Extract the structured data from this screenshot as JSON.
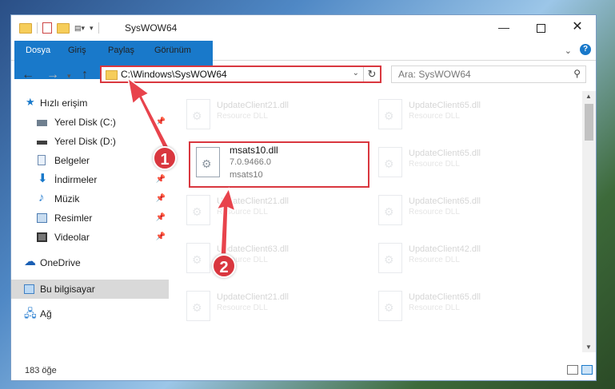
{
  "window": {
    "title": "SysWOW64",
    "controls": {
      "minimize": "—",
      "close": "✕"
    }
  },
  "ribbon": {
    "tabs": [
      "Dosya",
      "Giriş",
      "Paylaş",
      "Görünüm"
    ],
    "help": "?",
    "collapse": "⌄"
  },
  "nav": {
    "address": "C:\\Windows\\SysWOW64",
    "search_placeholder": "Ara: SysWOW64",
    "dropdown": "⌄",
    "refresh": "↻"
  },
  "sidebar": {
    "items": [
      {
        "label": "Hızlı erişim",
        "icon": "star-icon",
        "pinned": false
      },
      {
        "label": "Yerel Disk (C:)",
        "icon": "drive-icon",
        "pinned": true
      },
      {
        "label": "Yerel Disk (D:)",
        "icon": "drive-icon",
        "pinned": false
      },
      {
        "label": "Belgeler",
        "icon": "document-icon",
        "pinned": true
      },
      {
        "label": "İndirmeler",
        "icon": "download-icon",
        "pinned": true
      },
      {
        "label": "Müzik",
        "icon": "music-icon",
        "pinned": true
      },
      {
        "label": "Resimler",
        "icon": "pictures-icon",
        "pinned": true
      },
      {
        "label": "Videolar",
        "icon": "video-icon",
        "pinned": true
      },
      {
        "label": "OneDrive",
        "icon": "cloud-icon",
        "pinned": false
      },
      {
        "label": "Bu bilgisayar",
        "icon": "computer-icon",
        "pinned": false,
        "selected": true
      },
      {
        "label": "Ağ",
        "icon": "network-icon",
        "pinned": false
      }
    ]
  },
  "files": {
    "highlighted": {
      "name": "msats10.dll",
      "version": "7.0.9466.0",
      "description": "msats10"
    },
    "faded": [
      {
        "name": "UpdateClient21.dll",
        "desc": "Resource DLL"
      },
      {
        "name": "UpdateClient65.dll",
        "desc": "Resource DLL"
      },
      {
        "name": "UpdateClient65.dll",
        "desc": "Resource DLL"
      },
      {
        "name": "UpdateClient21.dll",
        "desc": "Resource DLL"
      },
      {
        "name": "UpdateClient65.dll",
        "desc": "Resource DLL"
      },
      {
        "name": "UpdateClient63.dll",
        "desc": "Resource DLL"
      },
      {
        "name": "UpdateClient42.dll",
        "desc": "Resource DLL"
      },
      {
        "name": "UpdateClient21.dll",
        "desc": "Resource DLL"
      },
      {
        "name": "UpdateClient65.dll",
        "desc": "Resource DLL"
      }
    ]
  },
  "status": {
    "count": "183 öğe"
  },
  "annotations": {
    "step1": "1",
    "step2": "2"
  },
  "colors": {
    "accent": "#1979ca",
    "highlight": "#d9373f"
  }
}
